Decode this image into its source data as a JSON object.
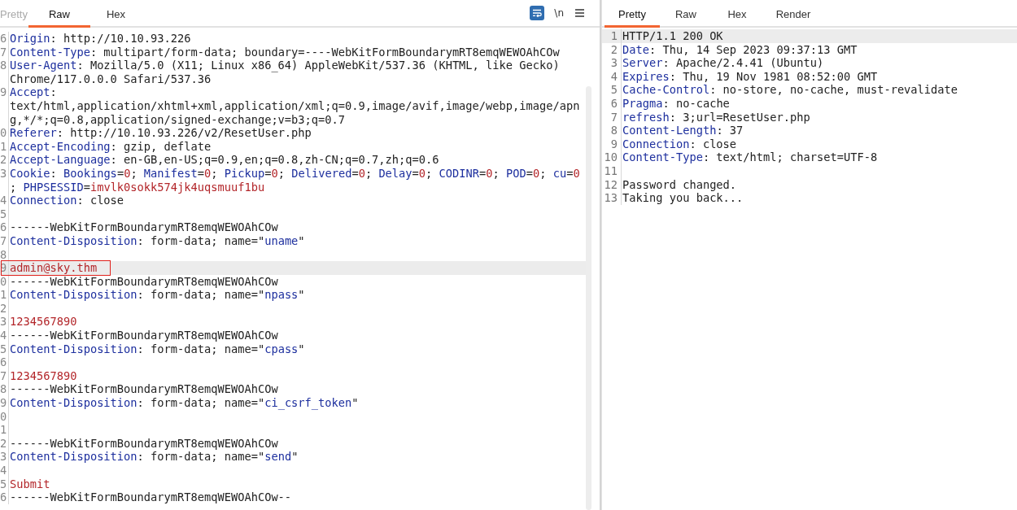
{
  "request": {
    "tabs": [
      {
        "label": "Pretty",
        "selected": false,
        "disabled": true
      },
      {
        "label": "Raw",
        "selected": true,
        "disabled": false
      },
      {
        "label": "Hex",
        "selected": false,
        "disabled": false
      }
    ],
    "wrap_toggle": {
      "on": true
    },
    "newline_toggle": {
      "label": "\\n"
    },
    "lines": [
      {
        "n": "6",
        "highlighted": false,
        "boxed": false,
        "parts": [
          {
            "kind": "key",
            "text": "Origin"
          },
          {
            "kind": "plain",
            "text": ": http://10.10.93.226"
          }
        ]
      },
      {
        "n": "7",
        "highlighted": false,
        "boxed": false,
        "parts": [
          {
            "kind": "key",
            "text": "Content-Type"
          },
          {
            "kind": "plain",
            "text": ": multipart/form-data; boundary=----WebKitFormBoundarymRT8emqWEWOAhCOw"
          }
        ]
      },
      {
        "n": "8",
        "highlighted": false,
        "boxed": false,
        "parts": [
          {
            "kind": "key",
            "text": "User-Agent"
          },
          {
            "kind": "plain",
            "text": ": Mozilla/5.0 (X11; Linux x86_64) AppleWebKit/537.36 (KHTML, like Gecko)"
          }
        ]
      },
      {
        "highlighted": false,
        "boxed": false,
        "parts": [
          {
            "kind": "plain",
            "text": "Chrome/117.0.0.0 Safari/537.36"
          }
        ]
      },
      {
        "n": "9",
        "highlighted": false,
        "boxed": false,
        "parts": [
          {
            "kind": "key",
            "text": "Accept"
          },
          {
            "kind": "plain",
            "text": ":"
          }
        ]
      },
      {
        "highlighted": false,
        "boxed": false,
        "parts": [
          {
            "kind": "plain",
            "text": "text/html,application/xhtml+xml,application/xml;q=0.9,image/avif,image/webp,image/apn"
          }
        ]
      },
      {
        "highlighted": false,
        "boxed": false,
        "parts": [
          {
            "kind": "plain",
            "text": "g,*/*;q=0.8,application/signed-exchange;v=b3;q=0.7"
          }
        ]
      },
      {
        "n": "0",
        "highlighted": false,
        "boxed": false,
        "parts": [
          {
            "kind": "key",
            "text": "Referer"
          },
          {
            "kind": "plain",
            "text": ": http://10.10.93.226/v2/ResetUser.php"
          }
        ]
      },
      {
        "n": "1",
        "highlighted": false,
        "boxed": false,
        "parts": [
          {
            "kind": "key",
            "text": "Accept-Encoding"
          },
          {
            "kind": "plain",
            "text": ": gzip, deflate"
          }
        ]
      },
      {
        "n": "2",
        "highlighted": false,
        "boxed": false,
        "parts": [
          {
            "kind": "key",
            "text": "Accept-Language"
          },
          {
            "kind": "plain",
            "text": ": en-GB,en-US;q=0.9,en;q=0.8,zh-CN;q=0.7,zh;q=0.6"
          }
        ]
      },
      {
        "n": "3",
        "highlighted": false,
        "boxed": false,
        "parts": [
          {
            "kind": "key",
            "text": "Cookie"
          },
          {
            "kind": "plain",
            "text": ": "
          },
          {
            "kind": "param",
            "text": "Bookings"
          },
          {
            "kind": "plain",
            "text": "="
          },
          {
            "kind": "value",
            "text": "0"
          },
          {
            "kind": "plain",
            "text": "; "
          },
          {
            "kind": "param",
            "text": "Manifest"
          },
          {
            "kind": "plain",
            "text": "="
          },
          {
            "kind": "value",
            "text": "0"
          },
          {
            "kind": "plain",
            "text": "; "
          },
          {
            "kind": "param",
            "text": "Pickup"
          },
          {
            "kind": "plain",
            "text": "="
          },
          {
            "kind": "value",
            "text": "0"
          },
          {
            "kind": "plain",
            "text": "; "
          },
          {
            "kind": "param",
            "text": "Delivered"
          },
          {
            "kind": "plain",
            "text": "="
          },
          {
            "kind": "value",
            "text": "0"
          },
          {
            "kind": "plain",
            "text": "; "
          },
          {
            "kind": "param",
            "text": "Delay"
          },
          {
            "kind": "plain",
            "text": "="
          },
          {
            "kind": "value",
            "text": "0"
          },
          {
            "kind": "plain",
            "text": "; "
          },
          {
            "kind": "param",
            "text": "CODINR"
          },
          {
            "kind": "plain",
            "text": "="
          },
          {
            "kind": "value",
            "text": "0"
          },
          {
            "kind": "plain",
            "text": "; "
          },
          {
            "kind": "param",
            "text": "POD"
          },
          {
            "kind": "plain",
            "text": "="
          },
          {
            "kind": "value",
            "text": "0"
          },
          {
            "kind": "plain",
            "text": "; "
          },
          {
            "kind": "param",
            "text": "cu"
          },
          {
            "kind": "plain",
            "text": "="
          },
          {
            "kind": "value",
            "text": "0"
          }
        ]
      },
      {
        "highlighted": false,
        "boxed": false,
        "parts": [
          {
            "kind": "plain",
            "text": "; "
          },
          {
            "kind": "param",
            "text": "PHPSESSID"
          },
          {
            "kind": "plain",
            "text": "="
          },
          {
            "kind": "value",
            "text": "imvlk0sokk574jk4uqsmuuf1bu"
          }
        ]
      },
      {
        "n": "4",
        "highlighted": false,
        "boxed": false,
        "parts": [
          {
            "kind": "key",
            "text": "Connection"
          },
          {
            "kind": "plain",
            "text": ": close"
          }
        ]
      },
      {
        "n": "5",
        "highlighted": false,
        "boxed": false
      },
      {
        "n": "6",
        "highlighted": false,
        "boxed": false,
        "parts": [
          {
            "kind": "plain",
            "text": "------WebKitFormBoundarymRT8emqWEWOAhCOw"
          }
        ]
      },
      {
        "n": "7",
        "highlighted": false,
        "boxed": false,
        "parts": [
          {
            "kind": "key",
            "text": "Content-Disposition"
          },
          {
            "kind": "plain",
            "text": ": form-data; name=\""
          },
          {
            "kind": "param",
            "text": "uname"
          },
          {
            "kind": "plain",
            "text": "\""
          }
        ]
      },
      {
        "n": "8",
        "highlighted": false,
        "boxed": false
      },
      {
        "n": "9",
        "highlighted": true,
        "boxed": true,
        "parts": [
          {
            "kind": "value",
            "text": "admin@sky.thm"
          }
        ]
      },
      {
        "n": "0",
        "highlighted": false,
        "boxed": false,
        "parts": [
          {
            "kind": "plain",
            "text": "------WebKitFormBoundarymRT8emqWEWOAhCOw"
          }
        ]
      },
      {
        "n": "1",
        "highlighted": false,
        "boxed": false,
        "parts": [
          {
            "kind": "key",
            "text": "Content-Disposition"
          },
          {
            "kind": "plain",
            "text": ": form-data; name=\""
          },
          {
            "kind": "param",
            "text": "npass"
          },
          {
            "kind": "plain",
            "text": "\""
          }
        ]
      },
      {
        "n": "2",
        "highlighted": false,
        "boxed": false
      },
      {
        "n": "3",
        "highlighted": false,
        "boxed": false,
        "parts": [
          {
            "kind": "value",
            "text": "1234567890"
          }
        ]
      },
      {
        "n": "4",
        "highlighted": false,
        "boxed": false,
        "parts": [
          {
            "kind": "plain",
            "text": "------WebKitFormBoundarymRT8emqWEWOAhCOw"
          }
        ]
      },
      {
        "n": "5",
        "highlighted": false,
        "boxed": false,
        "parts": [
          {
            "kind": "key",
            "text": "Content-Disposition"
          },
          {
            "kind": "plain",
            "text": ": form-data; name=\""
          },
          {
            "kind": "param",
            "text": "cpass"
          },
          {
            "kind": "plain",
            "text": "\""
          }
        ]
      },
      {
        "n": "6",
        "highlighted": false,
        "boxed": false
      },
      {
        "n": "7",
        "highlighted": false,
        "boxed": false,
        "parts": [
          {
            "kind": "value",
            "text": "1234567890"
          }
        ]
      },
      {
        "n": "8",
        "highlighted": false,
        "boxed": false,
        "parts": [
          {
            "kind": "plain",
            "text": "------WebKitFormBoundarymRT8emqWEWOAhCOw"
          }
        ]
      },
      {
        "n": "9",
        "highlighted": false,
        "boxed": false,
        "parts": [
          {
            "kind": "key",
            "text": "Content-Disposition"
          },
          {
            "kind": "plain",
            "text": ": form-data; name=\""
          },
          {
            "kind": "param",
            "text": "ci_csrf_token"
          },
          {
            "kind": "plain",
            "text": "\""
          }
        ]
      },
      {
        "n": "0",
        "highlighted": false,
        "boxed": false
      },
      {
        "n": "1",
        "highlighted": false,
        "boxed": false
      },
      {
        "n": "2",
        "highlighted": false,
        "boxed": false,
        "parts": [
          {
            "kind": "plain",
            "text": "------WebKitFormBoundarymRT8emqWEWOAhCOw"
          }
        ]
      },
      {
        "n": "3",
        "highlighted": false,
        "boxed": false,
        "parts": [
          {
            "kind": "key",
            "text": "Content-Disposition"
          },
          {
            "kind": "plain",
            "text": ": form-data; name=\""
          },
          {
            "kind": "param",
            "text": "send"
          },
          {
            "kind": "plain",
            "text": "\""
          }
        ]
      },
      {
        "n": "4",
        "highlighted": false,
        "boxed": false
      },
      {
        "n": "5",
        "highlighted": false,
        "boxed": false,
        "parts": [
          {
            "kind": "value",
            "text": "Submit"
          }
        ]
      },
      {
        "n": "6",
        "highlighted": false,
        "boxed": false,
        "parts": [
          {
            "kind": "plain",
            "text": "------WebKitFormBoundarymRT8emqWEWOAhCOw--"
          }
        ]
      }
    ]
  },
  "response": {
    "tabs": [
      {
        "label": "Pretty",
        "selected": true,
        "disabled": false
      },
      {
        "label": "Raw",
        "selected": false,
        "disabled": false
      },
      {
        "label": "Hex",
        "selected": false,
        "disabled": false
      },
      {
        "label": "Render",
        "selected": false,
        "disabled": false
      }
    ],
    "lines": [
      {
        "n": "1",
        "highlighted": true,
        "parts": [
          {
            "kind": "plain",
            "text": "HTTP/1.1 200 OK"
          }
        ]
      },
      {
        "n": "2",
        "highlighted": false,
        "parts": [
          {
            "kind": "key",
            "text": "Date"
          },
          {
            "kind": "plain",
            "text": ": Thu, 14 Sep 2023 09:37:13 GMT"
          }
        ]
      },
      {
        "n": "3",
        "highlighted": false,
        "parts": [
          {
            "kind": "key",
            "text": "Server"
          },
          {
            "kind": "plain",
            "text": ": Apache/2.4.41 (Ubuntu)"
          }
        ]
      },
      {
        "n": "4",
        "highlighted": false,
        "parts": [
          {
            "kind": "key",
            "text": "Expires"
          },
          {
            "kind": "plain",
            "text": ": Thu, 19 Nov 1981 08:52:00 GMT"
          }
        ]
      },
      {
        "n": "5",
        "highlighted": false,
        "parts": [
          {
            "kind": "key",
            "text": "Cache-Control"
          },
          {
            "kind": "plain",
            "text": ": no-store, no-cache, must-revalidate"
          }
        ]
      },
      {
        "n": "6",
        "highlighted": false,
        "parts": [
          {
            "kind": "key",
            "text": "Pragma"
          },
          {
            "kind": "plain",
            "text": ": no-cache"
          }
        ]
      },
      {
        "n": "7",
        "highlighted": false,
        "parts": [
          {
            "kind": "key",
            "text": "refresh"
          },
          {
            "kind": "plain",
            "text": ": 3;url=ResetUser.php"
          }
        ]
      },
      {
        "n": "8",
        "highlighted": false,
        "parts": [
          {
            "kind": "key",
            "text": "Content-Length"
          },
          {
            "kind": "plain",
            "text": ": 37"
          }
        ]
      },
      {
        "n": "9",
        "highlighted": false,
        "parts": [
          {
            "kind": "key",
            "text": "Connection"
          },
          {
            "kind": "plain",
            "text": ": close"
          }
        ]
      },
      {
        "n": "10",
        "highlighted": false,
        "parts": [
          {
            "kind": "key",
            "text": "Content-Type"
          },
          {
            "kind": "plain",
            "text": ": text/html; charset=UTF-8"
          }
        ]
      },
      {
        "n": "11",
        "highlighted": false
      },
      {
        "n": "12",
        "highlighted": false,
        "parts": [
          {
            "kind": "plain",
            "text": "Password changed."
          }
        ]
      },
      {
        "n": "13",
        "highlighted": false,
        "parts": [
          {
            "kind": "plain",
            "text": "Taking you back..."
          }
        ]
      }
    ]
  }
}
